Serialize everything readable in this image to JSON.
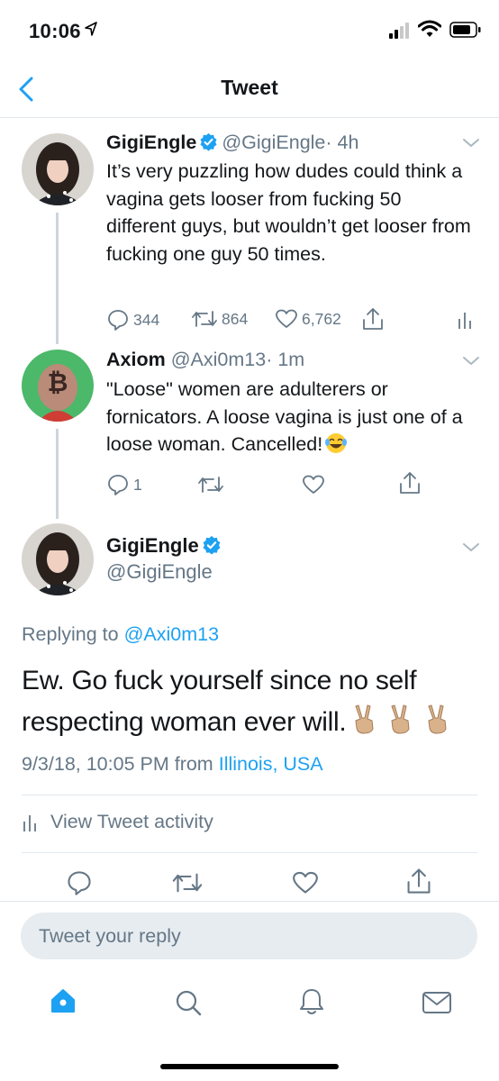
{
  "status_bar": {
    "time": "10:06"
  },
  "nav": {
    "title": "Tweet"
  },
  "tweets": [
    {
      "name": "GigiEngle",
      "handle": "@GigiEngle",
      "time": "· 4h",
      "text": "It’s very puzzling how dudes could think a vagina gets looser from fucking 50 different guys, but wouldn’t get looser from fucking one guy 50 times.",
      "replies": "344",
      "retweets": "864",
      "likes": "6,762"
    },
    {
      "name": "Axiom",
      "handle": "@Axi0m13",
      "time": "· 1m",
      "text": "\"Loose\" women are adulterers or fornicators. A loose vagina is just one of a loose woman. Cancelled!",
      "replies": "1"
    }
  ],
  "main_tweet": {
    "name": "GigiEngle",
    "handle": "@GigiEngle",
    "replying_prefix": "Replying to",
    "replying_handle": "@Axi0m13",
    "text": "Ew. Go fuck yourself since no self respecting woman ever will.",
    "timestamp": "9/3/18, 10:05 PM from",
    "location": "Illinois, USA",
    "activity_label": "View Tweet activity"
  },
  "reply_box": {
    "placeholder": "Tweet your reply"
  },
  "tab_bar": {
    "icons": [
      "home-icon",
      "search-icon",
      "notifications-icon",
      "messages-icon"
    ]
  },
  "colors": {
    "accent": "#1da1f2",
    "secondary_text": "#657786",
    "divider": "#e1e8ed"
  }
}
